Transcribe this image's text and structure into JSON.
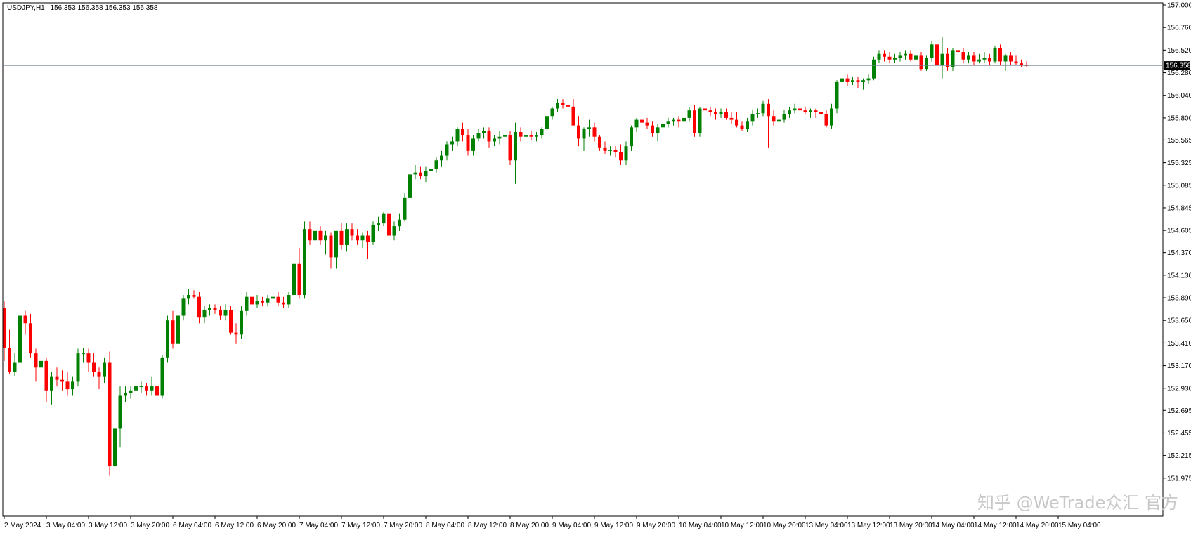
{
  "header": {
    "symbol": "USDJPY,H1",
    "ohlc": "156.353 156.358 156.353 156.358"
  },
  "watermark": "知乎 @WeTrade众汇 官方",
  "colors": {
    "background": "#ffffff",
    "bull": "#008000",
    "bear": "#ff0000",
    "axis": "#000000",
    "price_line": "#6f7f8f",
    "price_label_bg": "#000000",
    "price_label_text": "#ffffff"
  },
  "chart_data": {
    "type": "candlestick",
    "symbol": "USDJPY",
    "timeframe": "H1",
    "current_price": 156.358,
    "ylim": [
      151.735,
      157.0
    ],
    "y_ticks": [
      "157.000",
      "156.760",
      "156.520",
      "156.280",
      "156.040",
      "155.800",
      "155.565",
      "155.325",
      "155.085",
      "154.845",
      "154.605",
      "154.370",
      "154.130",
      "153.890",
      "153.650",
      "153.410",
      "153.170",
      "152.930",
      "152.695",
      "152.455",
      "152.215",
      "151.975"
    ],
    "x_ticks": [
      "2 May 2024",
      "3 May 04:00",
      "3 May 12:00",
      "3 May 20:00",
      "6 May 04:00",
      "6 May 12:00",
      "6 May 20:00",
      "7 May 04:00",
      "7 May 12:00",
      "7 May 20:00",
      "8 May 04:00",
      "8 May 12:00",
      "8 May 20:00",
      "9 May 04:00",
      "9 May 12:00",
      "9 May 20:00",
      "10 May 04:00",
      "10 May 12:00",
      "10 May 20:00",
      "13 May 04:00",
      "13 May 12:00",
      "13 May 20:00",
      "14 May 04:00",
      "14 May 12:00",
      "14 May 20:00",
      "15 May 04:00"
    ],
    "x_tick_bar_index": [
      0,
      8,
      16,
      24,
      32,
      40,
      48,
      56,
      64,
      72,
      80,
      88,
      96,
      104,
      112,
      120,
      128,
      136,
      144,
      152,
      160,
      168,
      176,
      184,
      192,
      200
    ],
    "bar_spacing_px": 7.5,
    "candles": [
      [
        153.78,
        153.85,
        153.22,
        153.36
      ],
      [
        153.36,
        153.55,
        153.08,
        153.1
      ],
      [
        153.1,
        153.3,
        153.06,
        153.2
      ],
      [
        153.2,
        153.8,
        153.15,
        153.7
      ],
      [
        153.7,
        153.75,
        153.5,
        153.62
      ],
      [
        153.62,
        153.72,
        153.25,
        153.3
      ],
      [
        153.3,
        153.35,
        153.0,
        153.15
      ],
      [
        153.15,
        153.48,
        153.1,
        153.22
      ],
      [
        153.22,
        153.25,
        152.78,
        152.9
      ],
      [
        152.9,
        153.1,
        152.75,
        153.05
      ],
      [
        153.05,
        153.15,
        152.95,
        153.02
      ],
      [
        153.02,
        153.12,
        152.9,
        153.0
      ],
      [
        153.0,
        153.1,
        152.85,
        152.92
      ],
      [
        152.92,
        153.05,
        152.85,
        153.0
      ],
      [
        153.0,
        153.35,
        152.95,
        153.3
      ],
      [
        153.3,
        153.36,
        153.2,
        153.3
      ],
      [
        153.3,
        153.35,
        153.1,
        153.2
      ],
      [
        153.2,
        153.3,
        153.05,
        153.1
      ],
      [
        153.1,
        153.15,
        152.92,
        153.05
      ],
      [
        153.05,
        153.25,
        152.98,
        153.2
      ],
      [
        153.2,
        153.32,
        152.0,
        152.1
      ],
      [
        152.1,
        152.55,
        152.0,
        152.5
      ],
      [
        152.5,
        152.95,
        152.3,
        152.85
      ],
      [
        152.85,
        152.95,
        152.78,
        152.88
      ],
      [
        152.88,
        152.95,
        152.82,
        152.9
      ],
      [
        152.9,
        152.98,
        152.85,
        152.95
      ],
      [
        152.95,
        153.0,
        152.88,
        152.95
      ],
      [
        152.95,
        152.98,
        152.85,
        152.9
      ],
      [
        152.9,
        153.05,
        152.85,
        152.95
      ],
      [
        152.95,
        153.0,
        152.8,
        152.85
      ],
      [
        152.85,
        153.28,
        152.82,
        153.25
      ],
      [
        153.25,
        153.7,
        153.2,
        153.65
      ],
      [
        153.65,
        153.75,
        153.35,
        153.4
      ],
      [
        153.4,
        153.75,
        153.35,
        153.7
      ],
      [
        153.7,
        153.92,
        153.65,
        153.88
      ],
      [
        153.88,
        153.98,
        153.82,
        153.92
      ],
      [
        153.92,
        153.97,
        153.88,
        153.9
      ],
      [
        153.9,
        153.95,
        153.62,
        153.68
      ],
      [
        153.68,
        153.8,
        153.62,
        153.76
      ],
      [
        153.76,
        153.82,
        153.7,
        153.78
      ],
      [
        153.78,
        153.82,
        153.72,
        153.76
      ],
      [
        153.76,
        153.8,
        153.66,
        153.7
      ],
      [
        153.7,
        153.82,
        153.65,
        153.76
      ],
      [
        153.76,
        153.8,
        153.5,
        153.52
      ],
      [
        153.52,
        153.62,
        153.4,
        153.5
      ],
      [
        153.5,
        153.8,
        153.45,
        153.75
      ],
      [
        153.75,
        153.95,
        153.7,
        153.9
      ],
      [
        153.9,
        154.02,
        153.78,
        153.82
      ],
      [
        153.82,
        153.92,
        153.78,
        153.86
      ],
      [
        153.86,
        153.9,
        153.8,
        153.84
      ],
      [
        153.84,
        153.92,
        153.8,
        153.88
      ],
      [
        153.88,
        153.98,
        153.82,
        153.9
      ],
      [
        153.9,
        153.95,
        153.8,
        153.84
      ],
      [
        153.84,
        153.9,
        153.78,
        153.82
      ],
      [
        153.82,
        153.95,
        153.78,
        153.92
      ],
      [
        153.92,
        154.3,
        153.88,
        154.25
      ],
      [
        154.25,
        154.42,
        153.88,
        153.92
      ],
      [
        153.92,
        154.7,
        153.88,
        154.62
      ],
      [
        154.62,
        154.7,
        154.45,
        154.5
      ],
      [
        154.5,
        154.68,
        154.48,
        154.6
      ],
      [
        154.6,
        154.65,
        154.45,
        154.5
      ],
      [
        154.5,
        154.6,
        154.35,
        154.55
      ],
      [
        154.55,
        154.58,
        154.2,
        154.32
      ],
      [
        154.32,
        154.6,
        154.2,
        154.6
      ],
      [
        154.6,
        154.68,
        154.4,
        154.45
      ],
      [
        154.45,
        154.68,
        154.38,
        154.62
      ],
      [
        154.62,
        154.68,
        154.5,
        154.55
      ],
      [
        154.55,
        154.62,
        154.45,
        154.5
      ],
      [
        154.5,
        154.58,
        154.42,
        154.55
      ],
      [
        154.55,
        154.6,
        154.3,
        154.48
      ],
      [
        154.48,
        154.7,
        154.45,
        154.66
      ],
      [
        154.66,
        154.75,
        154.6,
        154.68
      ],
      [
        154.68,
        154.8,
        154.65,
        154.78
      ],
      [
        154.78,
        154.82,
        154.52,
        154.55
      ],
      [
        154.55,
        154.7,
        154.5,
        154.65
      ],
      [
        154.65,
        154.78,
        154.6,
        154.72
      ],
      [
        154.72,
        155.0,
        154.7,
        154.95
      ],
      [
        154.95,
        155.25,
        154.9,
        155.2
      ],
      [
        155.2,
        155.3,
        155.15,
        155.22
      ],
      [
        155.22,
        155.28,
        155.15,
        155.18
      ],
      [
        155.18,
        155.28,
        155.12,
        155.24
      ],
      [
        155.24,
        155.3,
        155.18,
        155.26
      ],
      [
        155.26,
        155.38,
        155.22,
        155.35
      ],
      [
        155.35,
        155.45,
        155.28,
        155.4
      ],
      [
        155.4,
        155.55,
        155.35,
        155.52
      ],
      [
        155.52,
        155.6,
        155.45,
        155.55
      ],
      [
        155.55,
        155.7,
        155.5,
        155.68
      ],
      [
        155.68,
        155.75,
        155.55,
        155.62
      ],
      [
        155.62,
        155.68,
        155.4,
        155.45
      ],
      [
        155.45,
        155.62,
        155.4,
        155.58
      ],
      [
        155.58,
        155.68,
        155.55,
        155.64
      ],
      [
        155.64,
        155.7,
        155.58,
        155.66
      ],
      [
        155.66,
        155.7,
        155.48,
        155.55
      ],
      [
        155.55,
        155.62,
        155.5,
        155.58
      ],
      [
        155.58,
        155.66,
        155.52,
        155.6
      ],
      [
        155.6,
        155.65,
        155.52,
        155.62
      ],
      [
        155.62,
        155.66,
        155.3,
        155.35
      ],
      [
        155.35,
        155.75,
        155.1,
        155.65
      ],
      [
        155.65,
        155.7,
        155.55,
        155.6
      ],
      [
        155.6,
        155.66,
        155.54,
        155.62
      ],
      [
        155.62,
        155.66,
        155.56,
        155.6
      ],
      [
        155.6,
        155.65,
        155.55,
        155.62
      ],
      [
        155.62,
        155.7,
        155.58,
        155.68
      ],
      [
        155.68,
        155.85,
        155.65,
        155.82
      ],
      [
        155.82,
        155.92,
        155.78,
        155.9
      ],
      [
        155.9,
        156.0,
        155.86,
        155.96
      ],
      [
        155.96,
        156.0,
        155.9,
        155.94
      ],
      [
        155.94,
        155.98,
        155.88,
        155.92
      ],
      [
        155.92,
        156.0,
        155.75,
        155.72
      ],
      [
        155.72,
        155.82,
        155.5,
        155.58
      ],
      [
        155.58,
        155.7,
        155.45,
        155.68
      ],
      [
        155.68,
        155.78,
        155.6,
        155.7
      ],
      [
        155.7,
        155.75,
        155.55,
        155.6
      ],
      [
        155.6,
        155.62,
        155.45,
        155.48
      ],
      [
        155.48,
        155.55,
        155.42,
        155.45
      ],
      [
        155.45,
        155.5,
        155.4,
        155.46
      ],
      [
        155.46,
        155.5,
        155.38,
        155.44
      ],
      [
        155.44,
        155.52,
        155.3,
        155.35
      ],
      [
        155.35,
        155.55,
        155.3,
        155.5
      ],
      [
        155.5,
        155.72,
        155.45,
        155.7
      ],
      [
        155.7,
        155.8,
        155.65,
        155.78
      ],
      [
        155.78,
        155.82,
        155.72,
        155.75
      ],
      [
        155.75,
        155.8,
        155.68,
        155.72
      ],
      [
        155.72,
        155.76,
        155.6,
        155.64
      ],
      [
        155.64,
        155.74,
        155.55,
        155.7
      ],
      [
        155.7,
        155.8,
        155.66,
        155.74
      ],
      [
        155.74,
        155.8,
        155.7,
        155.76
      ],
      [
        155.76,
        155.8,
        155.72,
        155.78
      ],
      [
        155.78,
        155.82,
        155.7,
        155.76
      ],
      [
        155.76,
        155.84,
        155.72,
        155.8
      ],
      [
        155.8,
        155.92,
        155.76,
        155.88
      ],
      [
        155.88,
        155.94,
        155.6,
        155.64
      ],
      [
        155.64,
        155.92,
        155.6,
        155.9
      ],
      [
        155.9,
        155.95,
        155.84,
        155.88
      ],
      [
        155.88,
        155.92,
        155.82,
        155.86
      ],
      [
        155.86,
        155.9,
        155.78,
        155.84
      ],
      [
        155.84,
        155.9,
        155.8,
        155.86
      ],
      [
        155.86,
        155.9,
        155.78,
        155.8
      ],
      [
        155.8,
        155.86,
        155.74,
        155.78
      ],
      [
        155.78,
        155.86,
        155.7,
        155.72
      ],
      [
        155.72,
        155.76,
        155.66,
        155.68
      ],
      [
        155.68,
        155.8,
        155.65,
        155.76
      ],
      [
        155.76,
        155.88,
        155.72,
        155.84
      ],
      [
        155.84,
        155.9,
        155.8,
        155.85
      ],
      [
        155.85,
        155.98,
        155.82,
        155.95
      ],
      [
        155.95,
        156.0,
        155.48,
        155.82
      ],
      [
        155.82,
        155.88,
        155.72,
        155.76
      ],
      [
        155.76,
        155.82,
        155.72,
        155.78
      ],
      [
        155.78,
        155.88,
        155.75,
        155.84
      ],
      [
        155.84,
        155.92,
        155.8,
        155.88
      ],
      [
        155.88,
        155.95,
        155.85,
        155.9
      ],
      [
        155.9,
        155.95,
        155.82,
        155.88
      ],
      [
        155.88,
        155.92,
        155.84,
        155.86
      ],
      [
        155.86,
        155.9,
        155.8,
        155.88
      ],
      [
        155.88,
        155.9,
        155.8,
        155.86
      ],
      [
        155.86,
        155.9,
        155.82,
        155.84
      ],
      [
        155.84,
        155.88,
        155.7,
        155.72
      ],
      [
        155.72,
        155.95,
        155.68,
        155.9
      ],
      [
        155.9,
        156.2,
        155.85,
        156.18
      ],
      [
        156.18,
        156.25,
        156.12,
        156.22
      ],
      [
        156.22,
        156.26,
        156.14,
        156.18
      ],
      [
        156.18,
        156.24,
        156.15,
        156.2
      ],
      [
        156.2,
        156.24,
        156.12,
        156.18
      ],
      [
        156.18,
        156.22,
        156.1,
        156.2
      ],
      [
        156.2,
        156.26,
        156.16,
        156.22
      ],
      [
        156.22,
        156.45,
        156.2,
        156.42
      ],
      [
        156.42,
        156.52,
        156.38,
        156.48
      ],
      [
        156.48,
        156.52,
        156.4,
        156.45
      ],
      [
        156.45,
        156.5,
        156.38,
        156.42
      ],
      [
        156.42,
        156.48,
        156.38,
        156.44
      ],
      [
        156.44,
        156.5,
        156.4,
        156.46
      ],
      [
        156.46,
        156.52,
        156.42,
        156.48
      ],
      [
        156.48,
        156.52,
        156.4,
        156.42
      ],
      [
        156.42,
        156.5,
        156.38,
        156.46
      ],
      [
        156.46,
        156.5,
        156.3,
        156.32
      ],
      [
        156.32,
        156.46,
        156.3,
        156.44
      ],
      [
        156.44,
        156.62,
        156.4,
        156.58
      ],
      [
        156.58,
        156.78,
        156.28,
        156.36
      ],
      [
        156.36,
        156.66,
        156.22,
        156.48
      ],
      [
        156.48,
        156.54,
        156.3,
        156.34
      ],
      [
        156.34,
        156.54,
        156.3,
        156.52
      ],
      [
        156.52,
        156.56,
        156.44,
        156.5
      ],
      [
        156.5,
        156.54,
        156.38,
        156.42
      ],
      [
        156.42,
        156.5,
        156.38,
        156.46
      ],
      [
        156.46,
        156.5,
        156.36,
        156.4
      ],
      [
        156.4,
        156.48,
        156.38,
        156.42
      ],
      [
        156.42,
        156.5,
        156.38,
        156.44
      ],
      [
        156.44,
        156.48,
        156.36,
        156.4
      ],
      [
        156.4,
        156.56,
        156.38,
        156.54
      ],
      [
        156.54,
        156.58,
        156.36,
        156.4
      ],
      [
        156.4,
        156.48,
        156.3,
        156.46
      ],
      [
        156.46,
        156.5,
        156.36,
        156.4
      ],
      [
        156.4,
        156.46,
        156.36,
        156.38
      ],
      [
        156.38,
        156.42,
        156.34,
        156.36
      ],
      [
        156.36,
        156.4,
        156.34,
        156.358
      ]
    ]
  }
}
